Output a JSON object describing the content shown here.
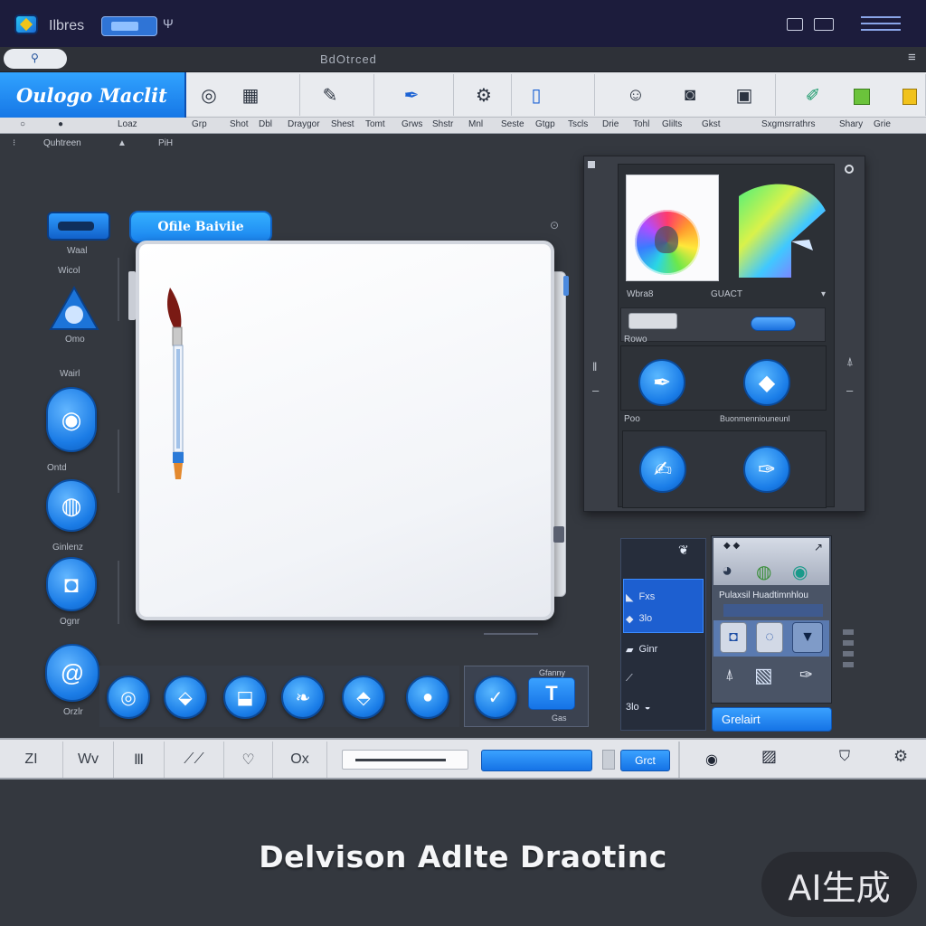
{
  "titlebar": {
    "app_name": "Ilbres",
    "tab_close": "Ψ"
  },
  "docbar": {
    "title": "BdOtrced",
    "menu": "≡"
  },
  "toolbar": {
    "brand": "Oulogo Maclit",
    "icons": [
      "camera-icon",
      "image-icon",
      "brush-settings-icon",
      "pen-icon",
      "nodes-icon",
      "device-icon",
      "face-icon",
      "portrait-icon",
      "frame-icon",
      "pencil-icon",
      "green-square-icon",
      "yellow-square-icon"
    ],
    "labels": [
      "Loaz",
      "Grp",
      "Shot",
      "Dbl",
      "Draygor",
      "Shest",
      "Tomt",
      "Grws",
      "Shstr",
      "Mnl",
      "Seste",
      "Gtgp",
      "Tscls",
      "Drie",
      "Tohl",
      "Glilts",
      "Gkst",
      "Sxgmsrrathrs",
      "Shary",
      "Grie"
    ]
  },
  "subrow": {
    "left": "Quhtreen",
    "right": "PiH"
  },
  "left_tools": {
    "labels": [
      "Waal",
      "Wicol",
      "Omo",
      "Wairl",
      "Ontd",
      "Ginlenz",
      "Ognr",
      "Orzlr"
    ]
  },
  "canvas": {
    "tab_label": "Ofile Baiviie"
  },
  "right_panel": {
    "swatch_label_left": "Wbra8",
    "swatch_label_right": "GUACT",
    "slider_label": "Rowo",
    "grid_label_left": "Poo",
    "grid_label_right": "Buonmenniouneunl"
  },
  "lower_right": {
    "rows": [
      "Fxs",
      "3lo",
      "Ginr",
      "3lo"
    ],
    "title": "Pulaxsil Huadtimnhlou",
    "button": "Grelairt"
  },
  "bottom_group": {
    "tag_top": "Gfanny",
    "tag_bottom": "Gas"
  },
  "statusbar": {
    "badge": "Grct",
    "cells": [
      "ZI",
      "Wv",
      "Ⅲ",
      "⟋⟋",
      "♡",
      "Ox"
    ]
  },
  "footer": {
    "title": "Delvison Adlte Draotinc"
  },
  "watermark": "AI生成",
  "colors": {
    "accent": "#1a83ee",
    "background": "#34383f",
    "titlebar": "#1c1c3c"
  }
}
